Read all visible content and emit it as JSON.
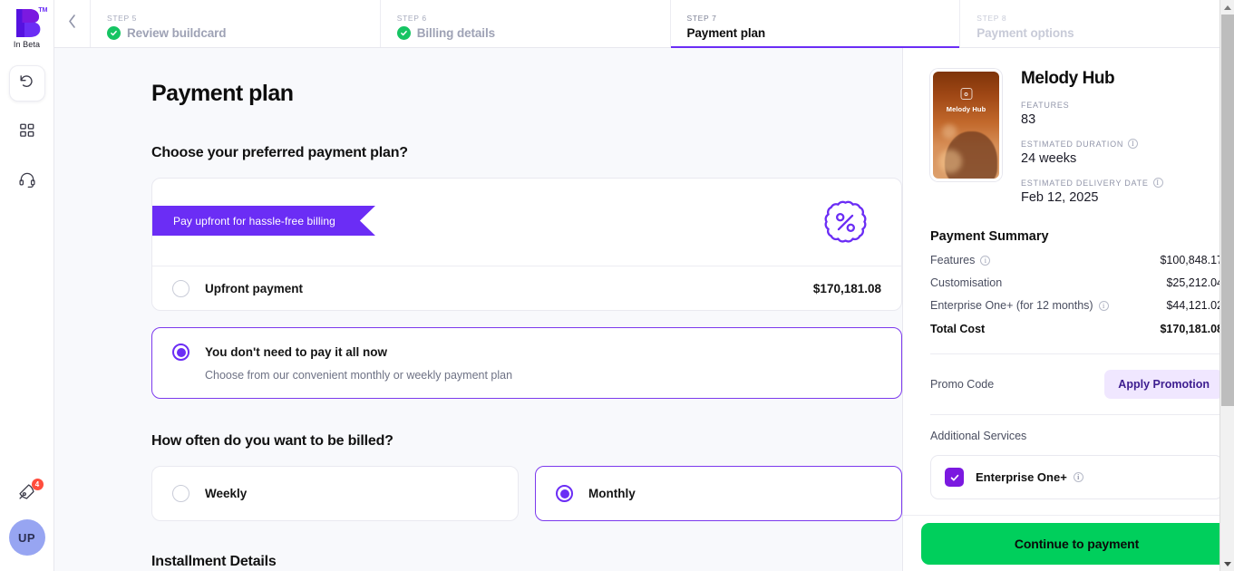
{
  "brand": {
    "logo_letter": "B",
    "trademark": "TM",
    "beta_label": "In Beta"
  },
  "rail": {
    "undo_icon": "undo-icon",
    "grid_icon": "grid-icon",
    "support_icon": "headset-icon",
    "rocket_icon": "rocket-icon",
    "rocket_badge": "4",
    "avatar_initials": "UP"
  },
  "stepper": {
    "back_icon": "chevron-left-icon",
    "steps": [
      {
        "key": "STEP 5",
        "label": "Review buildcard",
        "state": "done"
      },
      {
        "key": "STEP 6",
        "label": "Billing details",
        "state": "done"
      },
      {
        "key": "STEP 7",
        "label": "Payment plan",
        "state": "active"
      },
      {
        "key": "STEP 8",
        "label": "Payment options",
        "state": "todo"
      }
    ]
  },
  "main": {
    "page_title": "Payment plan",
    "question_plan": "Choose your preferred payment plan?",
    "ribbon_text": "Pay upfront for hassle-free billing",
    "discount_icon": "percent-badge-icon",
    "upfront": {
      "label": "Upfront payment",
      "price": "$170,181.08",
      "selected": false
    },
    "installments": {
      "label": "You don't need to pay it all now",
      "sublabel": "Choose from our convenient monthly or weekly payment plan",
      "selected": true
    },
    "question_frequency": "How often do you want to be billed?",
    "frequencies": [
      {
        "label": "Weekly",
        "selected": false
      },
      {
        "label": "Monthly",
        "selected": true
      }
    ],
    "installment_details_title": "Installment Details"
  },
  "summary": {
    "project": {
      "name": "Melody Hub",
      "thumb_name": "Melody Hub",
      "features_label": "FEATURES",
      "features_value": "83",
      "duration_label": "ESTIMATED DURATION",
      "duration_value": "24 weeks",
      "delivery_label": "ESTIMATED DELIVERY DATE",
      "delivery_value": "Feb 12, 2025"
    },
    "title": "Payment Summary",
    "rows": [
      {
        "label": "Features",
        "value": "$100,848.17",
        "info": true
      },
      {
        "label": "Customisation",
        "value": "$25,212.04",
        "info": false
      },
      {
        "label": "Enterprise One+ (for 12 months)",
        "value": "$44,121.02",
        "info": true
      }
    ],
    "total": {
      "label": "Total Cost",
      "value": "$170,181.08"
    },
    "promo_label": "Promo Code",
    "promo_button": "Apply Promotion",
    "additional_title": "Additional Services",
    "service": {
      "name": "Enterprise One+",
      "checked": true
    }
  },
  "footer": {
    "cta": "Continue to payment"
  },
  "colors": {
    "purple": "#6b2df5",
    "purple_dark": "#7c3aed",
    "green_check": "#16c463",
    "cta_green": "#00cf5c",
    "badge_red": "#ff4d3d",
    "promo_bg": "#f0e7ff"
  }
}
